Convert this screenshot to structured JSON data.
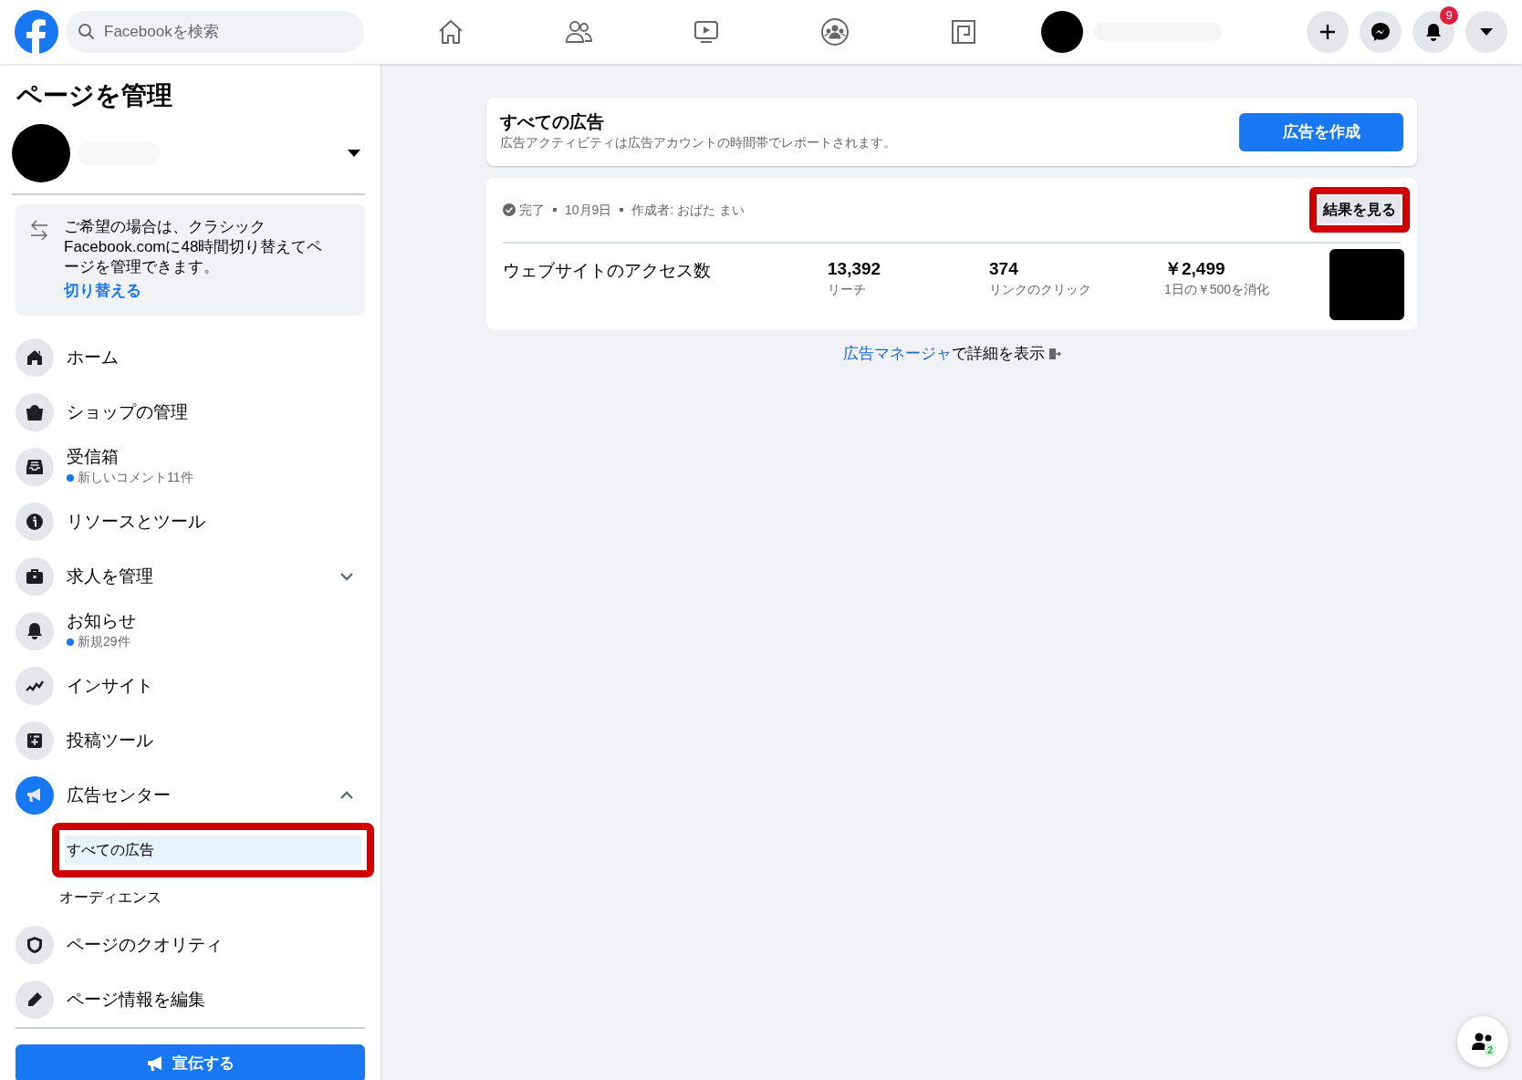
{
  "top_bar": {
    "search": {
      "placeholder": "Facebookを検索"
    },
    "notification_count": "9"
  },
  "sidebar": {
    "title": "ページを管理",
    "notice": {
      "text": "ご希望の場合は、クラシックFacebook.comに48時間切り替えてページを管理できます。",
      "link": "切り替える"
    },
    "items": [
      {
        "kind": "home",
        "label": "ホーム",
        "selected": false
      },
      {
        "kind": "shop",
        "label": "ショップの管理",
        "selected": false
      },
      {
        "kind": "inbox",
        "label": "受信箱",
        "sub": "新しいコメント11件",
        "selected": false
      },
      {
        "kind": "info",
        "label": "リソースとツール",
        "selected": false
      },
      {
        "kind": "jobs",
        "label": "求人を管理",
        "expanded": false,
        "selected": false
      },
      {
        "kind": "bell",
        "label": "お知らせ",
        "sub": "新規29件",
        "selected": false
      },
      {
        "kind": "insights",
        "label": "インサイト",
        "selected": false
      },
      {
        "kind": "post",
        "label": "投稿ツール",
        "selected": false
      },
      {
        "kind": "ads",
        "label": "広告センター",
        "expanded": true,
        "selected": true,
        "children": [
          {
            "label": "すべての広告",
            "selected": true
          },
          {
            "label": "オーディエンス",
            "selected": false
          }
        ]
      },
      {
        "kind": "quality",
        "label": "ページのクオリティ",
        "selected": false
      },
      {
        "kind": "edit",
        "label": "ページ情報を編集",
        "selected": false
      }
    ],
    "promote_button": "宣伝する"
  },
  "main": {
    "header": {
      "title": "すべての広告",
      "subtitle": "広告アクティビティは広告アカウントの時間帯でレポートされます。",
      "button": "広告を作成"
    },
    "ad": {
      "status": "完了",
      "date": "10月9日",
      "author": "作成者: おばた まい",
      "button": "結果を見る",
      "name": "ウェブサイトのアクセス数",
      "metrics": [
        {
          "value": "13,392",
          "label": "リーチ"
        },
        {
          "value": "374",
          "label": "リンクのクリック"
        },
        {
          "value": "￥2,499",
          "label": "1日の￥500を消化"
        }
      ]
    },
    "footer": {
      "link": "広告マネージャ",
      "text": "で詳細を表示"
    }
  },
  "contacts_count": "2"
}
